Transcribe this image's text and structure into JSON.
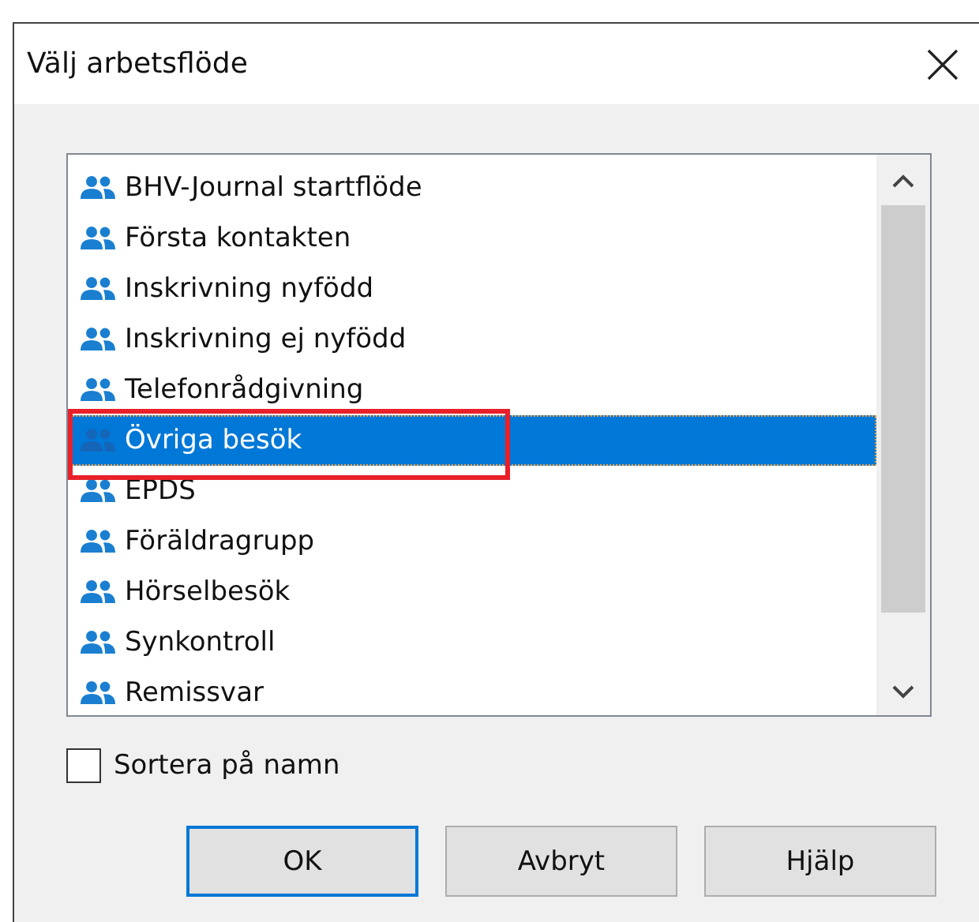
{
  "window": {
    "title": "Välj arbetsflöde"
  },
  "list": {
    "items": [
      {
        "label": "BHV-Journal startflöde",
        "selected": false,
        "highlighted": false
      },
      {
        "label": "Första kontakten",
        "selected": false,
        "highlighted": false
      },
      {
        "label": "Inskrivning nyfödd",
        "selected": false,
        "highlighted": false
      },
      {
        "label": "Inskrivning ej nyfödd",
        "selected": false,
        "highlighted": false
      },
      {
        "label": "Telefonrådgivning",
        "selected": false,
        "highlighted": false
      },
      {
        "label": "Övriga besök",
        "selected": true,
        "highlighted": true
      },
      {
        "label": "EPDS",
        "selected": false,
        "highlighted": false
      },
      {
        "label": "Föräldragrupp",
        "selected": false,
        "highlighted": false
      },
      {
        "label": "Hörselbesök",
        "selected": false,
        "highlighted": false
      },
      {
        "label": "Synkontroll",
        "selected": false,
        "highlighted": false
      },
      {
        "label": "Remissvar",
        "selected": false,
        "highlighted": false
      }
    ]
  },
  "sort_checkbox": {
    "label": "Sortera på namn",
    "checked": false
  },
  "buttons": [
    {
      "label": "OK",
      "default": true
    },
    {
      "label": "Avbryt",
      "default": false
    },
    {
      "label": "Hjälp",
      "default": false
    }
  ]
}
